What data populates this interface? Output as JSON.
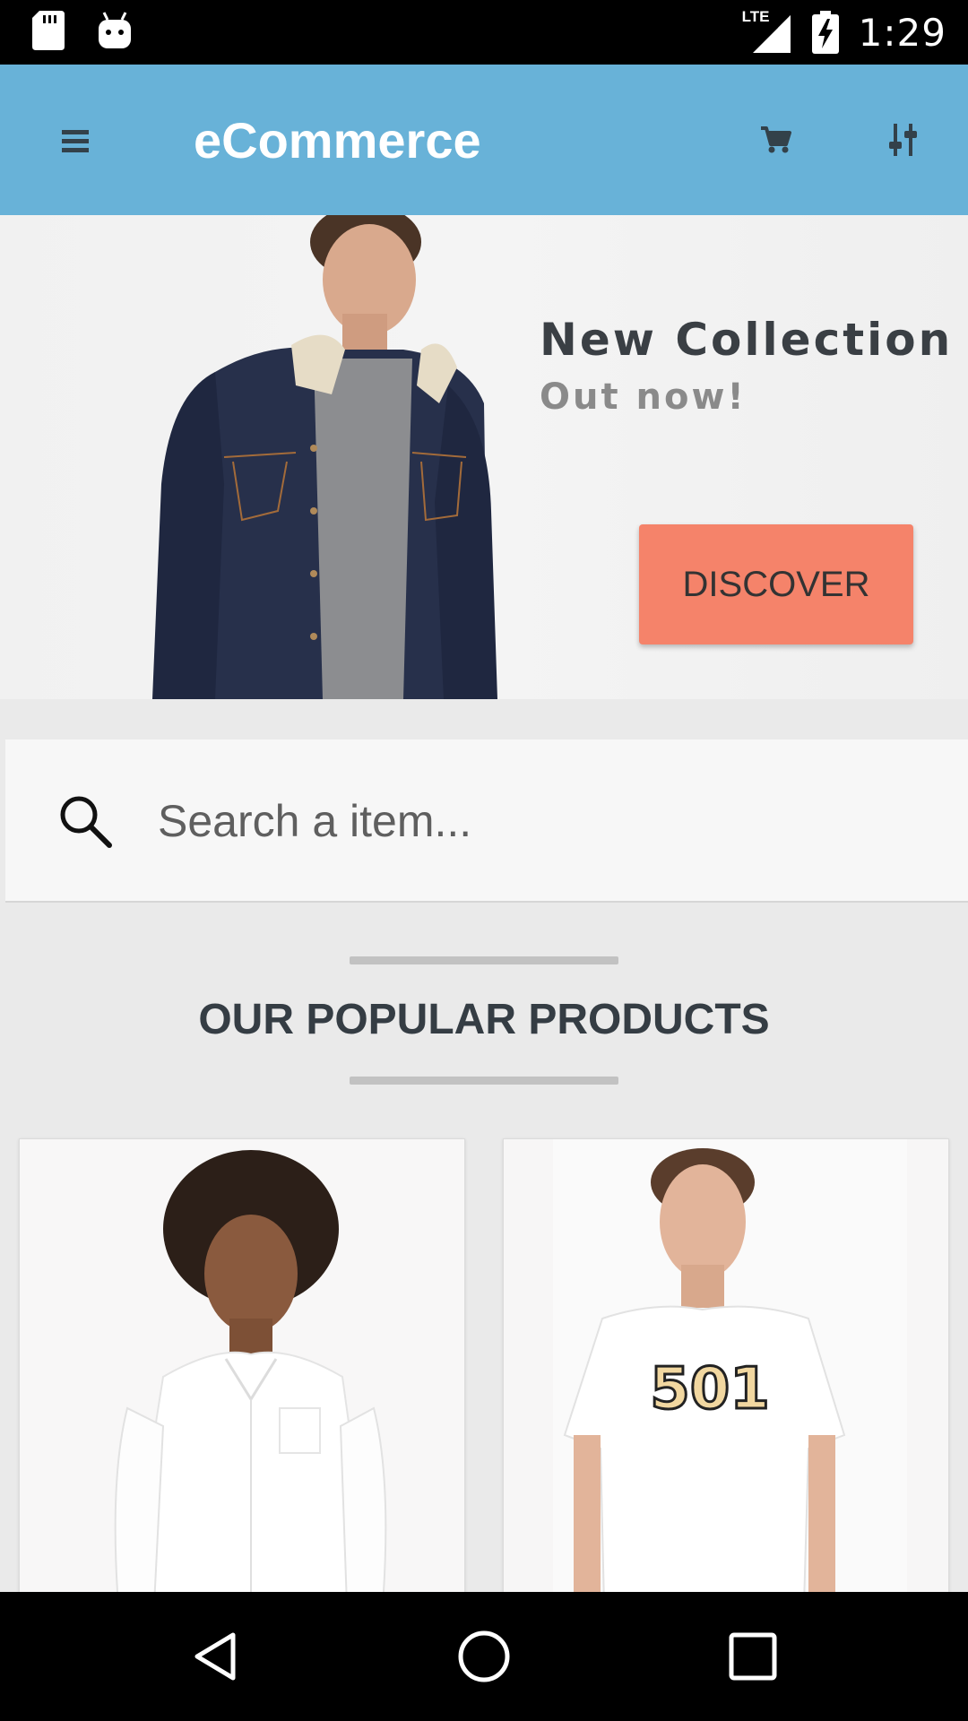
{
  "status_bar": {
    "time": "1:29",
    "network": "LTE",
    "icons": [
      "sd-card-icon",
      "android-debug-icon",
      "signal-icon",
      "battery-charging-icon"
    ]
  },
  "app_bar": {
    "title": "eCommerce",
    "background": "#68b2d8",
    "icons": [
      "menu-icon",
      "cart-icon",
      "filter-icon"
    ]
  },
  "banner": {
    "title": "New Collection",
    "subtitle": "Out now!",
    "cta_label": "DISCOVER",
    "cta_color": "#f5836a"
  },
  "search": {
    "placeholder": "Search a item..."
  },
  "popular": {
    "title": "OUR POPULAR PRODUCTS",
    "products": [
      {
        "image": "woman-white-shirt-photo"
      },
      {
        "image": "man-501-tshirt-photo",
        "print": "501"
      }
    ]
  },
  "nav_bar": {
    "buttons": [
      "back-icon",
      "home-icon",
      "recents-icon"
    ]
  }
}
